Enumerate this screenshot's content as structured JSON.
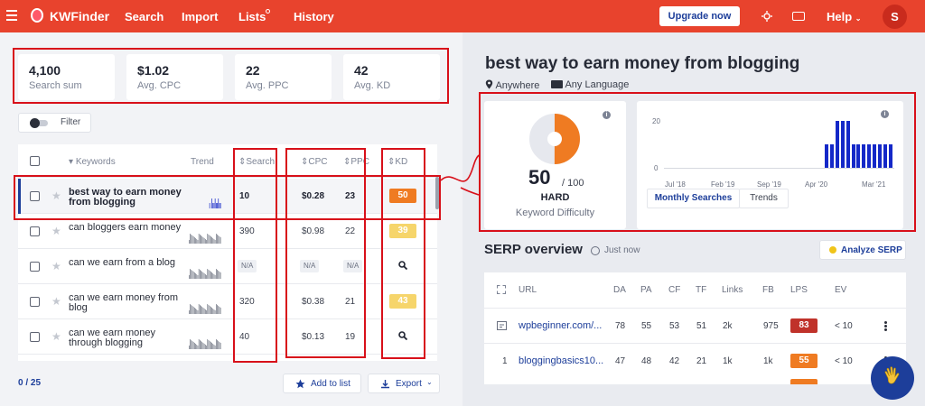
{
  "nav": {
    "brand": "KWFinder",
    "items": [
      "Search",
      "Import",
      "Lists",
      "History"
    ],
    "upgrade": "Upgrade now",
    "help": "Help",
    "avatar": "S"
  },
  "stats": [
    {
      "value": "4,100",
      "label": "Search sum"
    },
    {
      "value": "$1.02",
      "label": "Avg. CPC"
    },
    {
      "value": "22",
      "label": "Avg. PPC"
    },
    {
      "value": "42",
      "label": "Avg. KD"
    }
  ],
  "filter": {
    "label": "Filter"
  },
  "table": {
    "headers": {
      "keywords": "Keywords",
      "trend": "Trend",
      "search": "Search",
      "cpc": "CPC",
      "ppc": "PPC",
      "kd": "KD"
    },
    "rows": [
      {
        "keyword": "best way to earn money from blogging",
        "search": "10",
        "cpc": "$0.28",
        "ppc": "23",
        "kd": "50",
        "kd_color": "#ef7b22",
        "selected": true,
        "trend": [
          0,
          0,
          0,
          0,
          0,
          0,
          0,
          0,
          0,
          0,
          0,
          0,
          0,
          0,
          0,
          0,
          0,
          0,
          0,
          1,
          0,
          1,
          1,
          1,
          1,
          1,
          1,
          1,
          1,
          1
        ]
      },
      {
        "keyword": "can bloggers earn money",
        "search": "390",
        "cpc": "$0.98",
        "ppc": "22",
        "kd": "39",
        "kd_color": "#f6d56b",
        "selected": false,
        "trend": [
          1,
          1,
          1,
          1,
          1,
          1,
          1,
          1,
          1,
          1,
          1,
          1,
          1,
          1,
          1,
          1,
          1,
          1,
          1,
          1,
          1,
          1,
          1,
          1,
          1,
          1,
          1,
          1,
          1,
          1
        ]
      },
      {
        "keyword": "can we earn from a blog",
        "search": "N/A",
        "cpc": "N/A",
        "ppc": "N/A",
        "kd": "",
        "kd_color": "",
        "selected": false,
        "trend": [
          1,
          1,
          1,
          1,
          1,
          1,
          1,
          1,
          1,
          1,
          1,
          1,
          1,
          1,
          1,
          1,
          1,
          1,
          1,
          1,
          1,
          1,
          1,
          1,
          1,
          1,
          1,
          1,
          1,
          1
        ]
      },
      {
        "keyword": "can we earn money from blog",
        "search": "320",
        "cpc": "$0.38",
        "ppc": "21",
        "kd": "43",
        "kd_color": "#f6d56b",
        "selected": false,
        "trend": [
          1,
          1,
          1,
          1,
          1,
          1,
          1,
          1,
          1,
          1,
          1,
          1,
          1,
          1,
          1,
          1,
          1,
          1,
          1,
          1,
          1,
          1,
          1,
          1,
          1,
          1,
          1,
          1,
          1,
          1
        ]
      },
      {
        "keyword": "can we earn money through blogging",
        "search": "40",
        "cpc": "$0.13",
        "ppc": "19",
        "kd": "",
        "kd_color": "",
        "selected": false,
        "trend": [
          1,
          1,
          1,
          1,
          1,
          1,
          1,
          1,
          1,
          1,
          1,
          1,
          1,
          1,
          1,
          1,
          1,
          1,
          1,
          1,
          1,
          1,
          1,
          1,
          1,
          1,
          1,
          1,
          1,
          1
        ]
      }
    ]
  },
  "pager": "0 / 25",
  "actions": {
    "add_to_list": "Add to list",
    "export": "Export"
  },
  "detail": {
    "keyword": "best way to earn money from blogging",
    "location": "Anywhere",
    "language": "Any Language",
    "kd_value": "50",
    "kd_max": "/ 100",
    "kd_value_num": 50,
    "kd_grade": "HARD",
    "kd_label": "Keyword Difficulty",
    "tabs": [
      "Monthly Searches",
      "Trends"
    ]
  },
  "chart_data": {
    "type": "bar",
    "title": "",
    "yticks": [
      "20",
      "0"
    ],
    "xticks": [
      "Jul '18",
      "Feb '19",
      "Sep '19",
      "Apr '20",
      "Mar '21"
    ],
    "ylim": [
      0,
      20
    ],
    "values": [
      0,
      0,
      0,
      0,
      0,
      0,
      0,
      0,
      0,
      0,
      0,
      0,
      0,
      0,
      0,
      0,
      0,
      0,
      0,
      0,
      0,
      0,
      0,
      0,
      0,
      0,
      0,
      0,
      0,
      0,
      10,
      10,
      20,
      20,
      20,
      10,
      10,
      10,
      10,
      10,
      10,
      10,
      10
    ],
    "color": "#1428c8"
  },
  "serp": {
    "title": "SERP overview",
    "time": "Just now",
    "analyze": "Analyze SERP",
    "headers": [
      "URL",
      "DA",
      "PA",
      "CF",
      "TF",
      "Links",
      "FB",
      "LPS",
      "EV"
    ],
    "rows": [
      {
        "rank": "",
        "url": "wpbeginner.com/...",
        "da": "78",
        "pa": "55",
        "cf": "53",
        "tf": "51",
        "links": "2k",
        "fb": "975",
        "lps": "83",
        "lps_color": "#c0322a",
        "ev": "< 10"
      },
      {
        "rank": "1",
        "url": "bloggingbasics10...",
        "da": "47",
        "pa": "48",
        "cf": "42",
        "tf": "21",
        "links": "1k",
        "fb": "1k",
        "lps": "55",
        "lps_color": "#ef7b22",
        "ev": "< 10"
      }
    ]
  }
}
